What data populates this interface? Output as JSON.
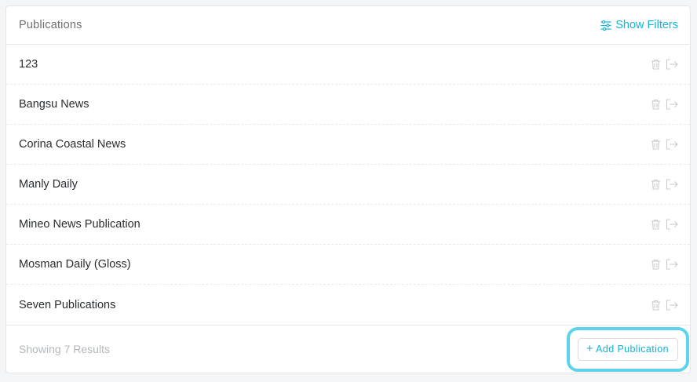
{
  "header": {
    "title": "Publications",
    "filters_label": "Show Filters",
    "filters_icon": "sliders-icon"
  },
  "publications": [
    {
      "name": "123"
    },
    {
      "name": "Bangsu News"
    },
    {
      "name": "Corina Coastal News"
    },
    {
      "name": "Manly Daily"
    },
    {
      "name": "Mineo News Publication"
    },
    {
      "name": "Mosman Daily (Gloss)"
    },
    {
      "name": "Seven Publications"
    }
  ],
  "row_actions": {
    "delete_icon": "trash-icon",
    "open_icon": "sign-out-icon"
  },
  "footer": {
    "results_text": "Showing 7 Results",
    "add_label": "Add Publication"
  },
  "colors": {
    "accent": "#14b3d6",
    "highlight": "#5fd3ec",
    "icon_muted": "#c9cdd1"
  }
}
